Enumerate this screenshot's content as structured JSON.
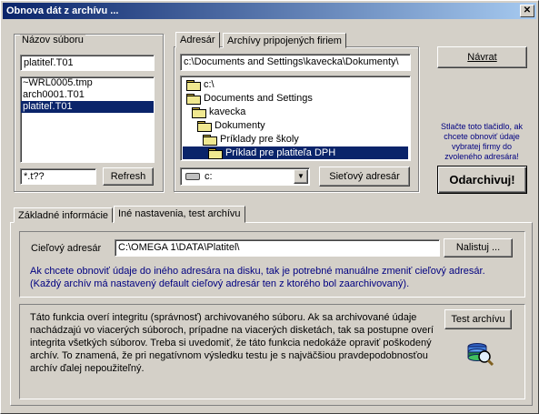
{
  "window": {
    "title": "Obnova dát z archívu ..."
  },
  "left_panel": {
    "label": "Názov súboru",
    "filename_value": "platiteľ.T01",
    "files": [
      "~WRL0005.tmp",
      "arch0001.T01",
      "platiteľ.T01"
    ],
    "selected_index": 2,
    "filter_value": "*.t??",
    "refresh_label": "Refresh"
  },
  "right_panel": {
    "tabs": [
      "Adresár",
      "Archívy pripojených firiem"
    ],
    "path_value": "c:\\Documents and Settings\\kavecka\\Dokumenty\\",
    "tree": [
      "c:\\",
      "Documents and Settings",
      "kavecka",
      "Dokumenty",
      "Príklady pre školy",
      "Príklad pre platiteľa DPH"
    ],
    "selected_index": 5,
    "drive_value": "c:",
    "network_label": "Sieťový adresár"
  },
  "actions": {
    "back_label": "Návrat",
    "hint_text": "Stlačte toto tlačidlo, ak chcete obnoviť údaje vybratej firmy do zvoleného adresára!",
    "unarchive_label": "Odarchivuj!"
  },
  "bottom_tabs": [
    "Základné informácie",
    "Iné nastavenia, test archívu"
  ],
  "target": {
    "label": "Cieľový adresár",
    "value": "C:\\OMEGA 1\\DATA\\Platitel\\",
    "find_label": "Nalistuj ...",
    "description": "Ak chcete obnoviť údaje do iného adresára na disku, tak je potrebné manuálne zmeniť cieľový adresár. (Každý archív má nastavený default cieľový adresár ten z ktorého bol zaarchivovaný)."
  },
  "test": {
    "description": "Táto funkcia overí integritu (správnosť) archivovaného súboru. Ak sa archivované údaje nachádzajú vo viacerých súboroch, prípadne na viacerých disketách, tak sa postupne overí integrita všetkých súborov. Treba si uvedomiť, že táto funkcia nedokáže opraviť poškodený archív. To znamená, že pri negatívnom výsledku testu je s najväčšiou pravdepodobnosťou archív ďalej nepoužiteľný.",
    "button_label": "Test archívu"
  }
}
